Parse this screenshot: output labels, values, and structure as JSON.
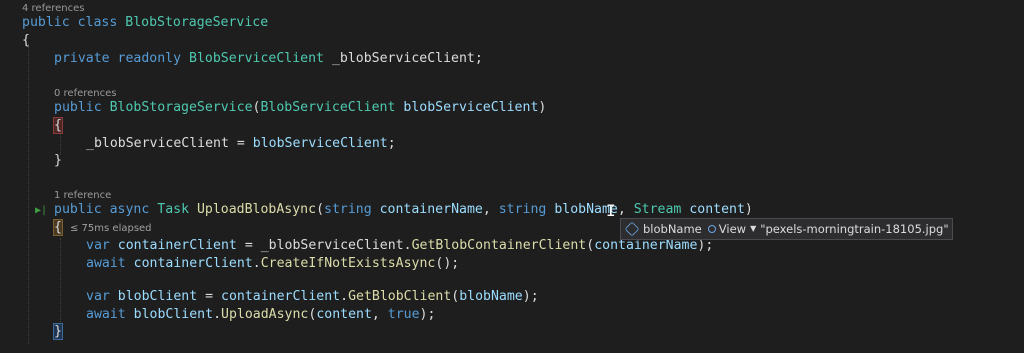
{
  "codelens": {
    "class_refs": "4 references",
    "ctor_refs": "0 references",
    "method_refs": "1 reference"
  },
  "code": {
    "l1_kw1": "public",
    "l1_kw2": "class",
    "l1_type": "BlobStorageService",
    "brace_open": "{",
    "brace_close": "}",
    "l3_kw1": "private",
    "l3_kw2": "readonly",
    "l3_type": "BlobServiceClient",
    "l3_field": "_blobServiceClient",
    "semicolon": ";",
    "l5_kw": "public",
    "l5_type": "BlobStorageService",
    "l5_paren_open": "(",
    "l5_ptype": "BlobServiceClient",
    "l5_param": "blobServiceClient",
    "l5_paren_close": ")",
    "l7_field": "_blobServiceClient",
    "l7_eq": " = ",
    "l7_param": "blobServiceClient",
    "l10_kw1": "public",
    "l10_kw2": "async",
    "l10_type": "Task",
    "l10_fn": "UploadBlobAsync",
    "l10_open": "(",
    "l10_kw3": "string",
    "l10_p1": "containerName",
    "l10_comma1": ", ",
    "l10_kw4": "string",
    "l10_p2": "blobName",
    "l10_comma2": ", ",
    "l10_ptype3": "Stream",
    "l10_p3": "content",
    "l10_close": ")",
    "l12_kw": "var",
    "l12_var": "containerClient",
    "l12_eq": " = ",
    "l12_field": "_blobServiceClient",
    "l12_dot": ".",
    "l12_fn": "GetBlobContainerClient",
    "l12_open": "(",
    "l12_arg": "containerName",
    "l12_close": ");",
    "l13_kw": "await",
    "l13_var": "containerClient",
    "l13_dot": ".",
    "l13_fn": "CreateIfNotExistsAsync",
    "l13_call": "();",
    "l15_kw": "var",
    "l15_var": "blobClient",
    "l15_eq": " = ",
    "l15_obj": "containerClient",
    "l15_dot": ".",
    "l15_fn": "GetBlobClient",
    "l15_open": "(",
    "l15_arg": "blobName",
    "l15_close": ");",
    "l16_kw": "await",
    "l16_var": "blobClient",
    "l16_dot": ".",
    "l16_fn": "UploadAsync",
    "l16_open": "(",
    "l16_arg": "content",
    "l16_comma": ", ",
    "l16_bool": "true",
    "l16_close": ");"
  },
  "debug": {
    "elapsed": "≤ 75ms elapsed",
    "tooltip_name": "blobName",
    "tooltip_view": "View",
    "tooltip_value": "\"pexels-morningtrain-18105.jpg\""
  },
  "icons": {
    "run_marker": "run-to-cursor-icon",
    "tooltip_icon": "variable-icon",
    "view_icon": "magnifier-icon",
    "cursor": "text-cursor-icon"
  },
  "colors": {
    "background": "#1e1e1e",
    "keyword": "#569cd6",
    "type": "#4ec9b0",
    "method": "#dcdcaa",
    "parameter": "#9cdcfe"
  }
}
